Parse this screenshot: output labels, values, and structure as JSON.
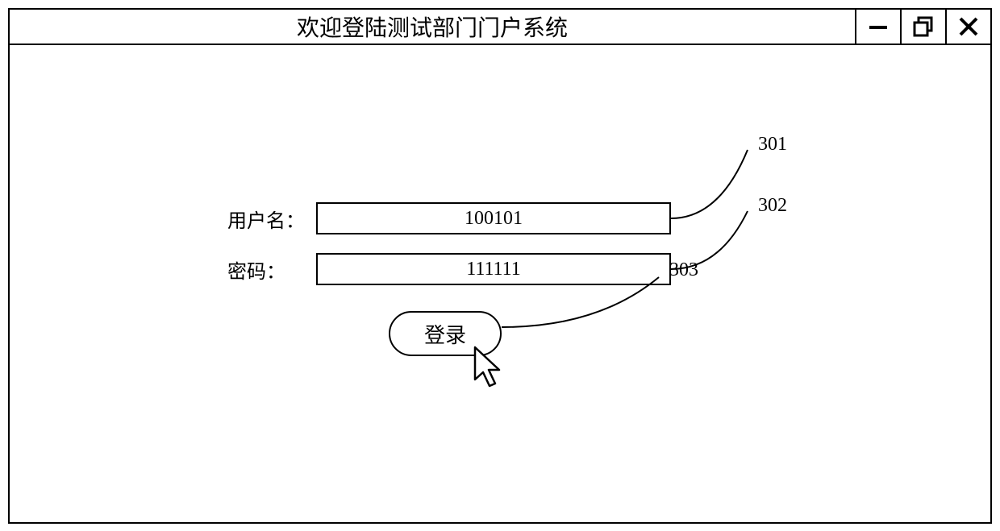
{
  "window": {
    "title": "欢迎登陆测试部门门户系统"
  },
  "form": {
    "username_label": "用户名：",
    "username_value": "100101",
    "password_label": "密码：",
    "password_value": "111111",
    "login_label": "登录"
  },
  "callouts": {
    "username": "301",
    "password": "302",
    "login": "303"
  }
}
